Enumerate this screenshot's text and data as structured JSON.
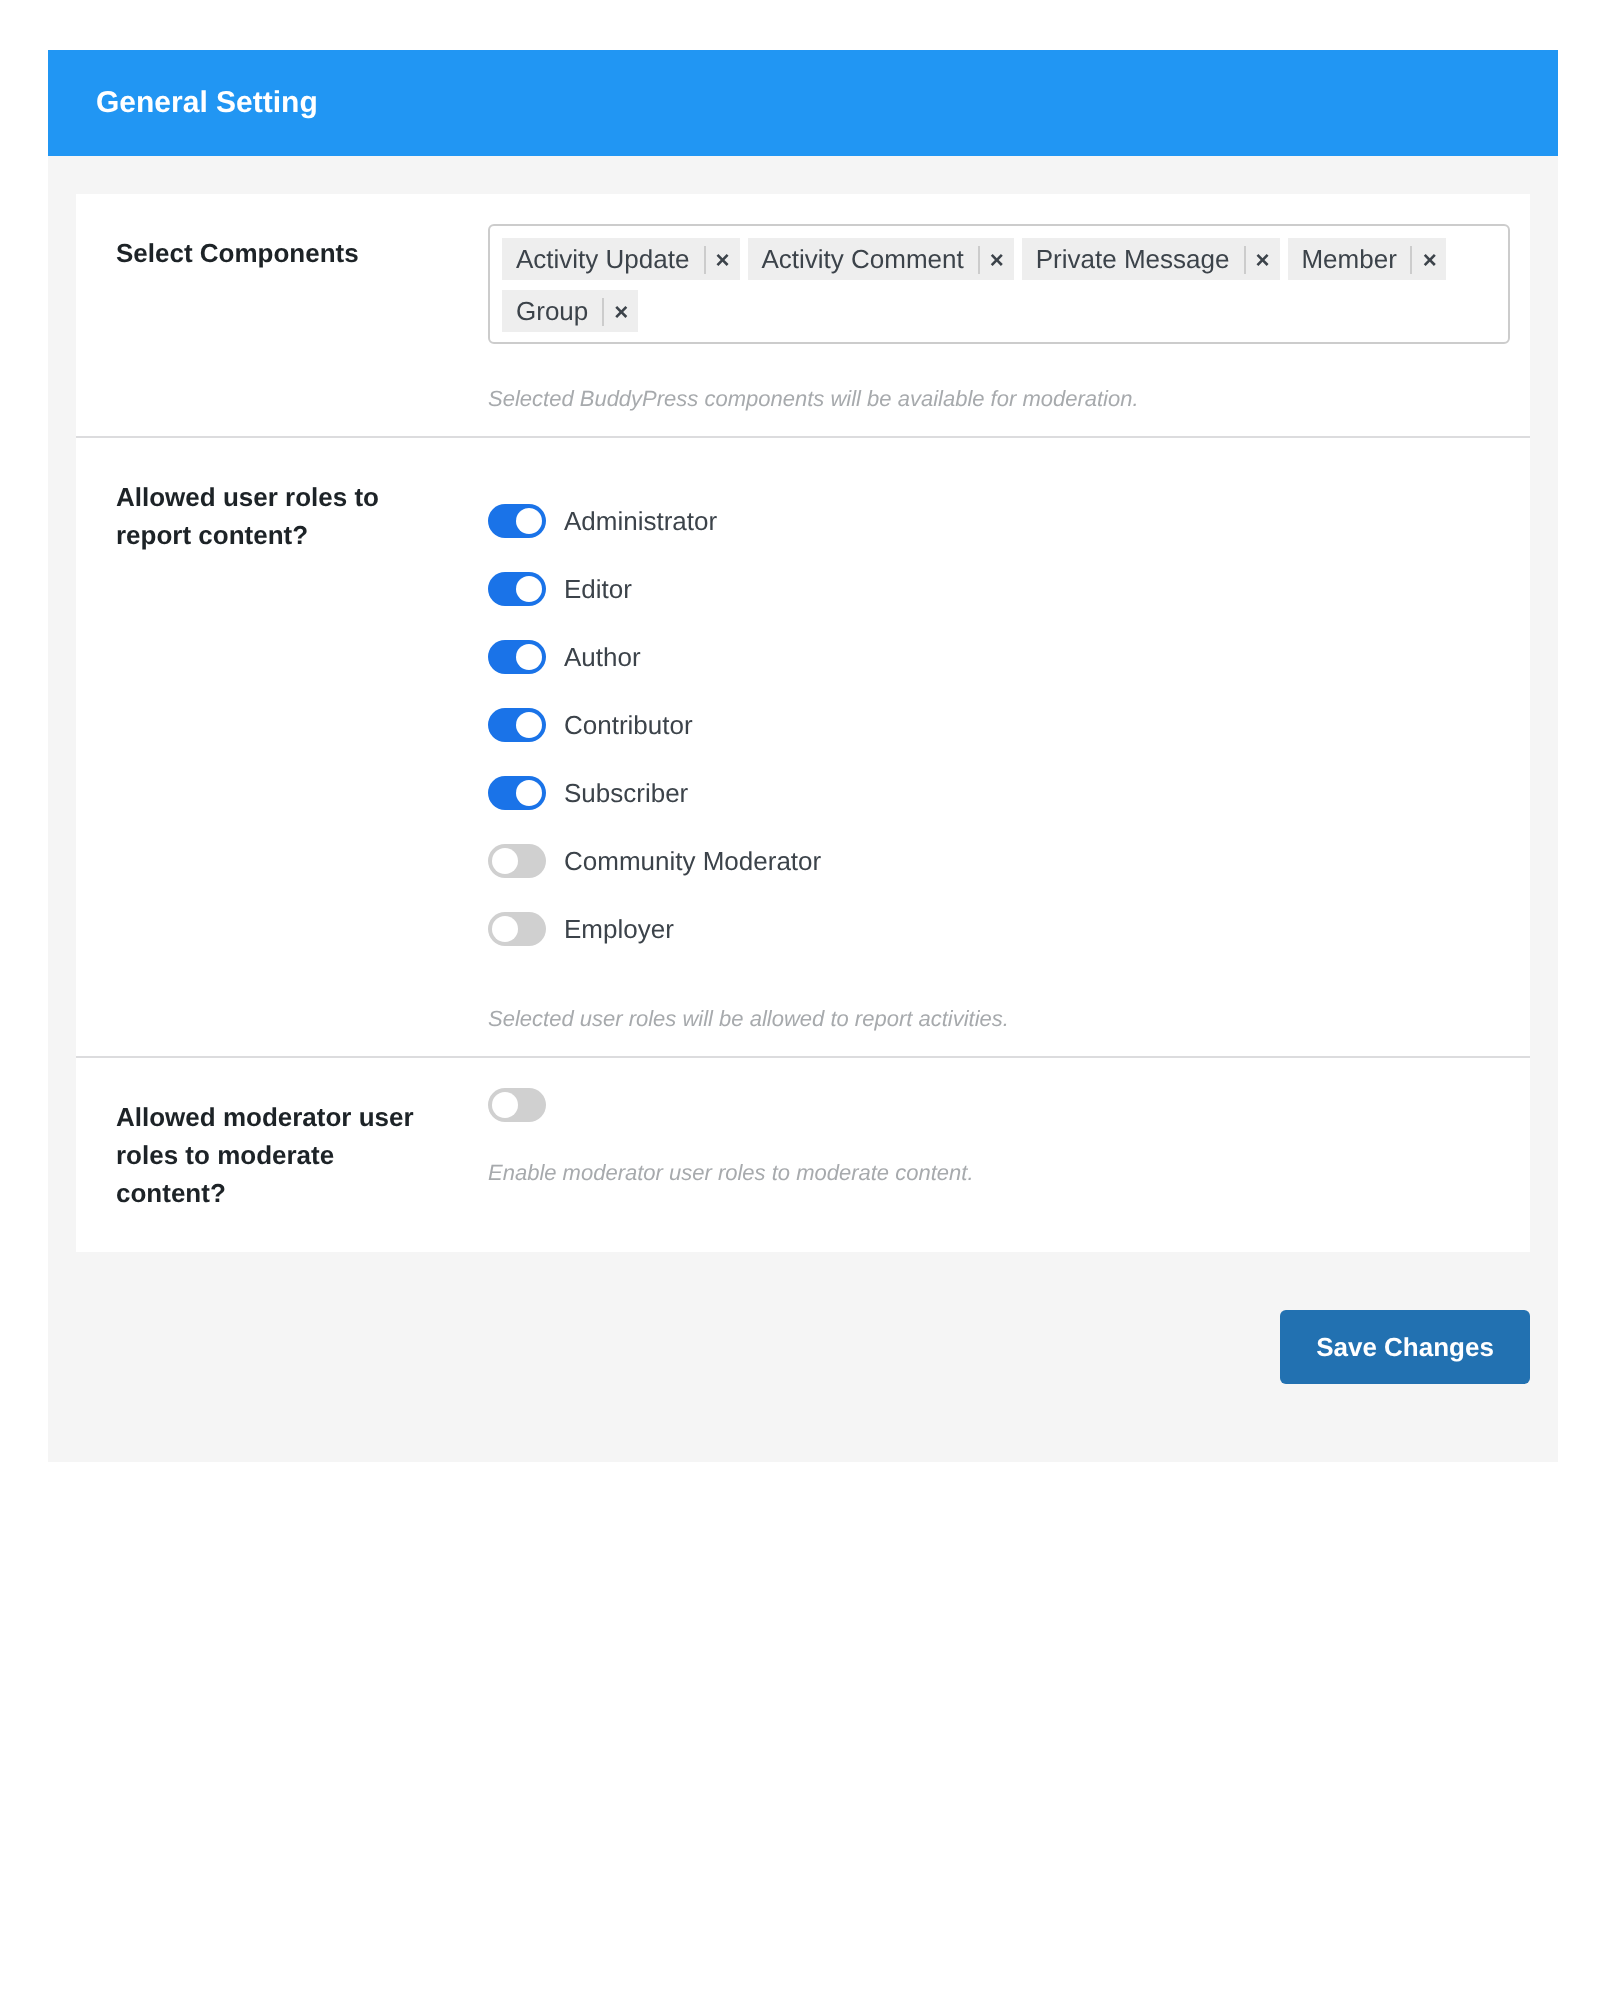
{
  "header": {
    "title": "General Setting"
  },
  "sections": [
    {
      "kind": "tags",
      "label": "Select Components",
      "tags": [
        {
          "label": "Activity Update",
          "remove": "×"
        },
        {
          "label": "Activity Comment",
          "remove": "×"
        },
        {
          "label": "Private Message",
          "remove": "×"
        },
        {
          "label": "Member",
          "remove": "×"
        },
        {
          "label": "Group",
          "remove": "×"
        }
      ],
      "help": "Selected BuddyPress components will be available for moderation."
    },
    {
      "kind": "toggles",
      "label": "Allowed user roles to report content?",
      "toggles": [
        {
          "label": "Administrator",
          "on": true
        },
        {
          "label": "Editor",
          "on": true
        },
        {
          "label": "Author",
          "on": true
        },
        {
          "label": "Contributor",
          "on": true
        },
        {
          "label": "Subscriber",
          "on": true
        },
        {
          "label": "Community Moderator",
          "on": false
        },
        {
          "label": "Employer",
          "on": false
        }
      ],
      "help": "Selected user roles will be allowed to report activities."
    },
    {
      "kind": "switch",
      "label": "Allowed moderator user roles to moderate content?",
      "on": false,
      "help": "Enable moderator user roles to moderate content."
    }
  ],
  "save_button": "Save Changes"
}
